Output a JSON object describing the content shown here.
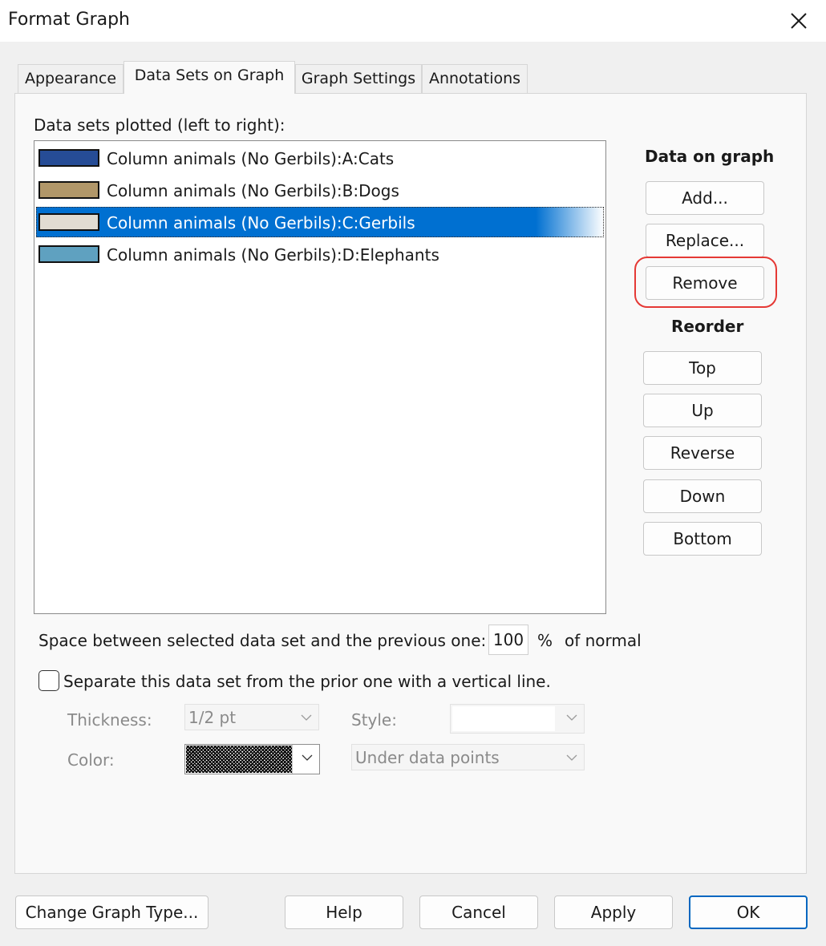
{
  "window": {
    "title": "Format Graph"
  },
  "tabs": [
    {
      "label": "Appearance",
      "active": false
    },
    {
      "label": "Data Sets on Graph",
      "active": true
    },
    {
      "label": "Graph Settings",
      "active": false
    },
    {
      "label": "Annotations",
      "active": false
    }
  ],
  "list": {
    "label": "Data sets plotted (left to right):",
    "items": [
      {
        "label": "Column animals (No Gerbils):A:Cats",
        "color": "#264c96",
        "selected": false
      },
      {
        "label": "Column animals (No Gerbils):B:Dogs",
        "color": "#b19769",
        "selected": false
      },
      {
        "label": "Column animals (No Gerbils):C:Gerbils",
        "color": "#e1dcd2",
        "selected": true
      },
      {
        "label": "Column animals (No Gerbils):D:Elephants",
        "color": "#5fa1c0",
        "selected": false
      }
    ]
  },
  "data_on_graph": {
    "heading": "Data on graph",
    "add": "Add...",
    "replace": "Replace...",
    "remove": "Remove",
    "highlight_color": "#e53935"
  },
  "reorder": {
    "heading": "Reorder",
    "top": "Top",
    "up": "Up",
    "reverse": "Reverse",
    "down": "Down",
    "bottom": "Bottom"
  },
  "spacing": {
    "label": "Space between selected data set and the previous one:",
    "value": "100",
    "percent": "%",
    "suffix": "of normal"
  },
  "separator": {
    "checkbox_label": "Separate this data set from the prior one with a vertical line.",
    "checked": false,
    "thickness_label": "Thickness:",
    "thickness_value": "1/2 pt",
    "style_label": "Style:",
    "style_value": "",
    "color_label": "Color:",
    "position_value": "Under data points"
  },
  "footer": {
    "change_graph_type": "Change Graph Type...",
    "help": "Help",
    "cancel": "Cancel",
    "apply": "Apply",
    "ok": "OK"
  },
  "colors": {
    "accent": "#0070d1",
    "default_button_border": "#0067c0"
  }
}
